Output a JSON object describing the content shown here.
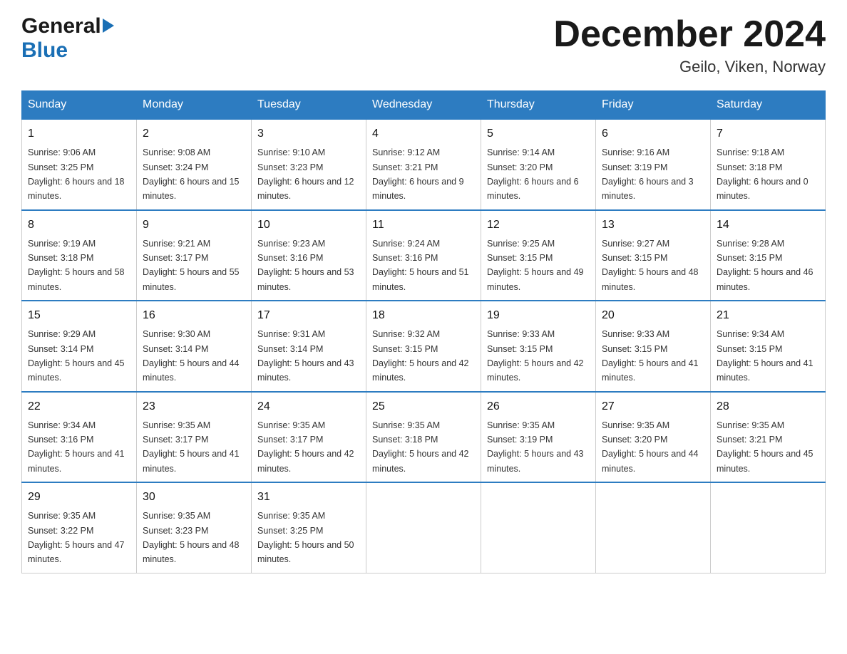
{
  "header": {
    "logo_general": "General",
    "logo_blue": "Blue",
    "month_title": "December 2024",
    "location": "Geilo, Viken, Norway"
  },
  "days_of_week": [
    "Sunday",
    "Monday",
    "Tuesday",
    "Wednesday",
    "Thursday",
    "Friday",
    "Saturday"
  ],
  "weeks": [
    [
      {
        "day": "1",
        "sunrise": "9:06 AM",
        "sunset": "3:25 PM",
        "daylight": "6 hours and 18 minutes."
      },
      {
        "day": "2",
        "sunrise": "9:08 AM",
        "sunset": "3:24 PM",
        "daylight": "6 hours and 15 minutes."
      },
      {
        "day": "3",
        "sunrise": "9:10 AM",
        "sunset": "3:23 PM",
        "daylight": "6 hours and 12 minutes."
      },
      {
        "day": "4",
        "sunrise": "9:12 AM",
        "sunset": "3:21 PM",
        "daylight": "6 hours and 9 minutes."
      },
      {
        "day": "5",
        "sunrise": "9:14 AM",
        "sunset": "3:20 PM",
        "daylight": "6 hours and 6 minutes."
      },
      {
        "day": "6",
        "sunrise": "9:16 AM",
        "sunset": "3:19 PM",
        "daylight": "6 hours and 3 minutes."
      },
      {
        "day": "7",
        "sunrise": "9:18 AM",
        "sunset": "3:18 PM",
        "daylight": "6 hours and 0 minutes."
      }
    ],
    [
      {
        "day": "8",
        "sunrise": "9:19 AM",
        "sunset": "3:18 PM",
        "daylight": "5 hours and 58 minutes."
      },
      {
        "day": "9",
        "sunrise": "9:21 AM",
        "sunset": "3:17 PM",
        "daylight": "5 hours and 55 minutes."
      },
      {
        "day": "10",
        "sunrise": "9:23 AM",
        "sunset": "3:16 PM",
        "daylight": "5 hours and 53 minutes."
      },
      {
        "day": "11",
        "sunrise": "9:24 AM",
        "sunset": "3:16 PM",
        "daylight": "5 hours and 51 minutes."
      },
      {
        "day": "12",
        "sunrise": "9:25 AM",
        "sunset": "3:15 PM",
        "daylight": "5 hours and 49 minutes."
      },
      {
        "day": "13",
        "sunrise": "9:27 AM",
        "sunset": "3:15 PM",
        "daylight": "5 hours and 48 minutes."
      },
      {
        "day": "14",
        "sunrise": "9:28 AM",
        "sunset": "3:15 PM",
        "daylight": "5 hours and 46 minutes."
      }
    ],
    [
      {
        "day": "15",
        "sunrise": "9:29 AM",
        "sunset": "3:14 PM",
        "daylight": "5 hours and 45 minutes."
      },
      {
        "day": "16",
        "sunrise": "9:30 AM",
        "sunset": "3:14 PM",
        "daylight": "5 hours and 44 minutes."
      },
      {
        "day": "17",
        "sunrise": "9:31 AM",
        "sunset": "3:14 PM",
        "daylight": "5 hours and 43 minutes."
      },
      {
        "day": "18",
        "sunrise": "9:32 AM",
        "sunset": "3:15 PM",
        "daylight": "5 hours and 42 minutes."
      },
      {
        "day": "19",
        "sunrise": "9:33 AM",
        "sunset": "3:15 PM",
        "daylight": "5 hours and 42 minutes."
      },
      {
        "day": "20",
        "sunrise": "9:33 AM",
        "sunset": "3:15 PM",
        "daylight": "5 hours and 41 minutes."
      },
      {
        "day": "21",
        "sunrise": "9:34 AM",
        "sunset": "3:15 PM",
        "daylight": "5 hours and 41 minutes."
      }
    ],
    [
      {
        "day": "22",
        "sunrise": "9:34 AM",
        "sunset": "3:16 PM",
        "daylight": "5 hours and 41 minutes."
      },
      {
        "day": "23",
        "sunrise": "9:35 AM",
        "sunset": "3:17 PM",
        "daylight": "5 hours and 41 minutes."
      },
      {
        "day": "24",
        "sunrise": "9:35 AM",
        "sunset": "3:17 PM",
        "daylight": "5 hours and 42 minutes."
      },
      {
        "day": "25",
        "sunrise": "9:35 AM",
        "sunset": "3:18 PM",
        "daylight": "5 hours and 42 minutes."
      },
      {
        "day": "26",
        "sunrise": "9:35 AM",
        "sunset": "3:19 PM",
        "daylight": "5 hours and 43 minutes."
      },
      {
        "day": "27",
        "sunrise": "9:35 AM",
        "sunset": "3:20 PM",
        "daylight": "5 hours and 44 minutes."
      },
      {
        "day": "28",
        "sunrise": "9:35 AM",
        "sunset": "3:21 PM",
        "daylight": "5 hours and 45 minutes."
      }
    ],
    [
      {
        "day": "29",
        "sunrise": "9:35 AM",
        "sunset": "3:22 PM",
        "daylight": "5 hours and 47 minutes."
      },
      {
        "day": "30",
        "sunrise": "9:35 AM",
        "sunset": "3:23 PM",
        "daylight": "5 hours and 48 minutes."
      },
      {
        "day": "31",
        "sunrise": "9:35 AM",
        "sunset": "3:25 PM",
        "daylight": "5 hours and 50 minutes."
      },
      null,
      null,
      null,
      null
    ]
  ],
  "labels": {
    "sunrise": "Sunrise:",
    "sunset": "Sunset:",
    "daylight": "Daylight:"
  }
}
